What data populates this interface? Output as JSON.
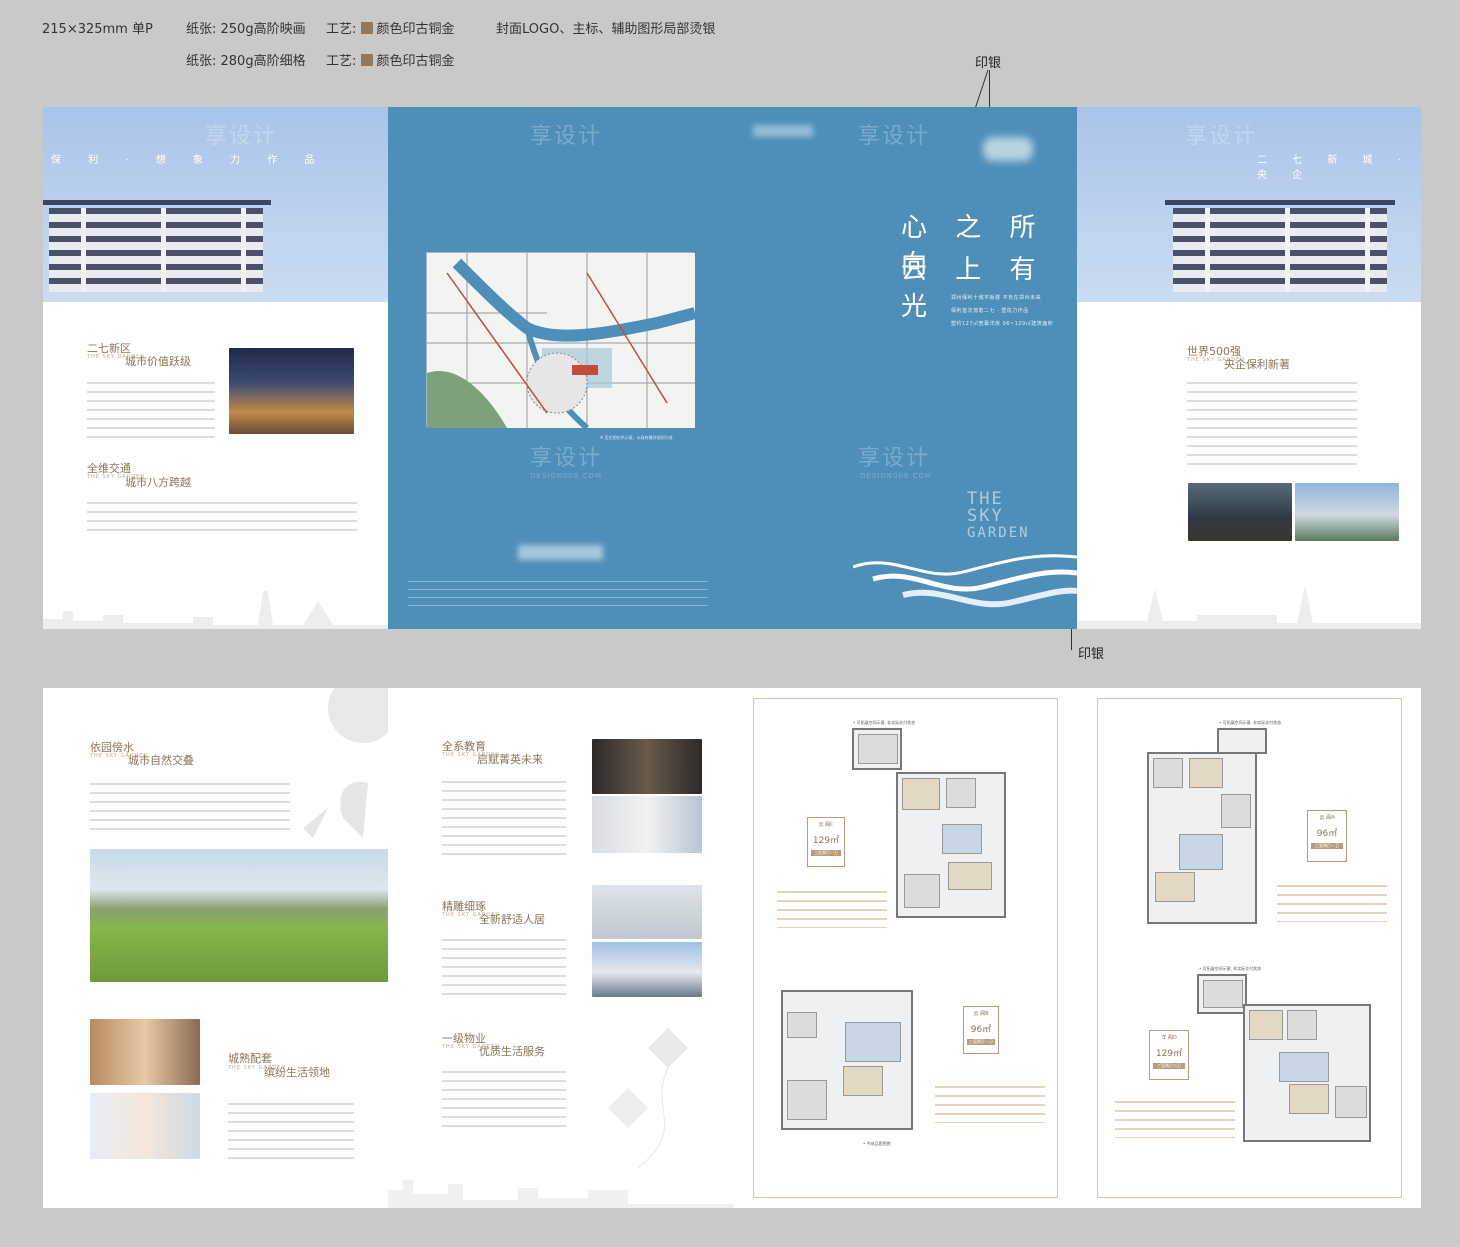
{
  "header": {
    "size": "215×325mm  单P",
    "paper1": "纸张: 250g高阶映画",
    "craft1_label": "工艺:",
    "craft1": "颜色印古铜金",
    "cover_note": "封面LOGO、主标、辅助图形局部烫银",
    "paper2": "纸张: 280g高阶细格",
    "craft2_label": "工艺:",
    "craft2": "颜色印古铜金"
  },
  "callouts": {
    "top": "印银",
    "bottom": "印银"
  },
  "colors": {
    "brand_blue": "#4e8fb9",
    "gold": "#8c7b5d",
    "background": "#c9c9c9"
  },
  "watermark": {
    "cn": "享设计",
    "en": "DESIGN006.COM"
  },
  "spread1": {
    "p1": {
      "tagline": "保 利 · 想 象 力 作 品",
      "sec1_title1": "二七新区",
      "sec1_title2": "城市价值跃级",
      "sec1_small": "THE SKY GARDEN",
      "sec2_title1": "全维交通",
      "sec2_title2": "城市八方跨越",
      "sec2_small": "THE SKY GARDEN"
    },
    "p2": {
      "map_caption": "※ 区位图仅供示意，以政府最终规划为准"
    },
    "p3": {
      "slogan1": "心 之 所 向",
      "slogan2": "云 上 有 光",
      "sub1": "郑州保利十城平板楼 不负在郑州未来",
      "sub2": "保利首次落笔二七 · 塑造力作品",
      "sub3": "塑约127㎡宽幕洋房 96~129㎡建筑面积",
      "logo_en1": "THE",
      "logo_en2": "SKY",
      "logo_en3": "GARDEN"
    },
    "p4": {
      "tagline": "二 七 新 城 · 央 企",
      "sec_title1": "世界500强",
      "sec_title2": "央企保利新著",
      "sec_small": "THE SKY GARDEN"
    }
  },
  "spread2": {
    "p1": {
      "sec1_title1": "依园傍水",
      "sec1_title2": "城市自然交叠",
      "sec1_small": "THE SKY GARDEN",
      "sec2_title1": "城熟配套",
      "sec2_title2": "缤纷生活领地",
      "sec2_small": "THE SKY GARDEN"
    },
    "p2": {
      "sec1_title1": "全系教育",
      "sec1_title2": "启赋菁英未来",
      "sec1_small": "THE SKY GARDEN",
      "sec2_title1": "精雕细琢",
      "sec2_title2": "全新舒适人居",
      "sec2_small": "THE SKY GARDEN",
      "sec3_title1": "一级物业",
      "sec3_title2": "优质生活服务",
      "sec3_small": "THE SKY GARDEN"
    },
    "p3": {
      "plan1_title": "• 可拓展空间示意, 非实际交付状态",
      "badge1": {
        "type": "云 阁C",
        "size": "129㎡",
        "foot": "三室两厅一卫"
      },
      "plan2_title": "• 今成品套图赏",
      "badge2": {
        "type": "云 阁B",
        "size": "96㎡",
        "foot": "三室两厅一卫"
      }
    },
    "p4": {
      "plan1_title": "• 可拓展空间示意, 非实际交付状态",
      "badge1": {
        "type": "云 阁A",
        "size": "96㎡",
        "foot": "三室两厅一卫"
      },
      "plan2_title": "• 可拓展空间示意, 非实际交付状态",
      "badge2": {
        "type": "洋 阁D",
        "size": "129㎡",
        "foot": "三室两厅二卫"
      }
    }
  }
}
